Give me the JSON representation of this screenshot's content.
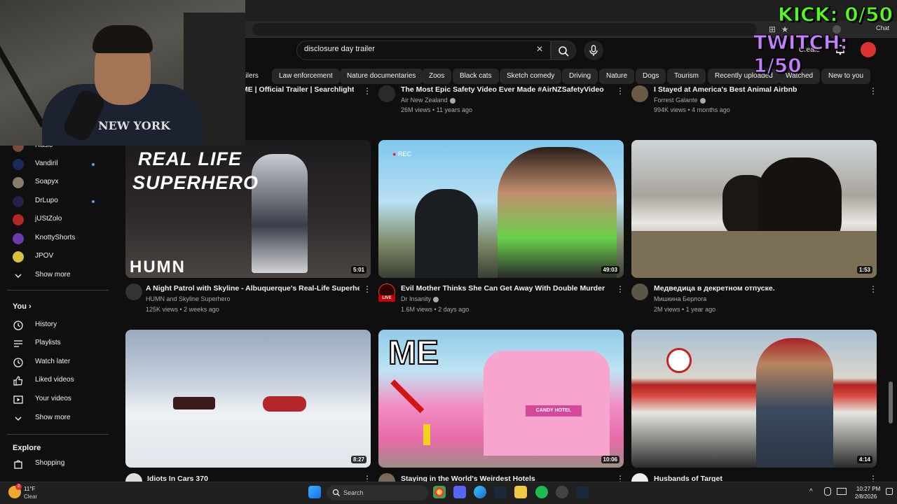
{
  "browser": {
    "chat_label": "Chat"
  },
  "overlay": {
    "kick": "KICK: 0/50",
    "twitch": "TWITCH: 1/50"
  },
  "webcam": {
    "hoodie_text": "NEW YORK"
  },
  "header": {
    "search_query": "disclosure day trailer",
    "create_label": "Create"
  },
  "chips": [
    "ailers",
    "Law enforcement",
    "Nature documentaries",
    "Zoos",
    "Black cats",
    "Sketch comedy",
    "Driving",
    "Nature",
    "Dogs",
    "Tourism",
    "Recently uploaded",
    "Watched",
    "New to you"
  ],
  "sidebar": {
    "subscriptions": [
      {
        "label": "Rasic",
        "icon": "channel-avatar"
      },
      {
        "label": "Vandiril",
        "icon": "channel-avatar",
        "live": true
      },
      {
        "label": "Soapyx",
        "icon": "channel-avatar"
      },
      {
        "label": "DrLupo",
        "icon": "channel-avatar",
        "live": true
      },
      {
        "label": "jUStZolo",
        "icon": "channel-avatar"
      },
      {
        "label": "KnottyShorts",
        "icon": "channel-avatar"
      },
      {
        "label": "JPOV",
        "icon": "channel-avatar"
      },
      {
        "label": "Show more",
        "icon": "chevron-down-icon"
      }
    ],
    "you_heading": "You",
    "you_items": [
      {
        "label": "History",
        "icon": "history-icon"
      },
      {
        "label": "Playlists",
        "icon": "playlists-icon"
      },
      {
        "label": "Watch later",
        "icon": "clock-icon"
      },
      {
        "label": "Liked videos",
        "icon": "thumbs-up-icon"
      },
      {
        "label": "Your videos",
        "icon": "your-videos-icon"
      },
      {
        "label": "Show more",
        "icon": "chevron-down-icon"
      }
    ],
    "explore_heading": "Explore",
    "explore_items": [
      {
        "label": "Shopping",
        "icon": "shopping-bag-icon"
      }
    ]
  },
  "top_row": [
    {
      "title": "ME | Official Trailer | Searchlight",
      "channel": "",
      "meta": ""
    },
    {
      "title": "The Most Epic Safety Video Ever Made #AirNZSafetyVideo",
      "channel": "Air New Zealand",
      "meta": "26M views • 11 years ago"
    },
    {
      "title": "I Stayed at America's Best Animal Airbnb",
      "channel": "Forrest Galante",
      "meta": "994K views • 4 months ago"
    }
  ],
  "videos": [
    {
      "title": "A Night Patrol with Skyline - Albuquerque's  Real-Life Superhero",
      "channel": "HUMN and Skyline Superhero",
      "meta": "125K views • 2 weeks ago",
      "duration": "5:01",
      "thumb_text_1": "REAL LIFE",
      "thumb_text_2": "SUPERHERO",
      "thumb_logo": "HUMN"
    },
    {
      "title": "Evil Mother Thinks She Can Get Away With Double Murder",
      "channel": "Dr Insanity",
      "meta": "1.6M views • 2 days ago",
      "duration": "49:03",
      "thumb_rec": "REC",
      "live_badge": "LIVE"
    },
    {
      "title": "Медведица в декретном отпуске.",
      "channel": "Мишкина Берлога",
      "meta": "2M views • 1 year ago",
      "duration": "1:53"
    },
    {
      "title": "Idiots In Cars 370",
      "channel": "",
      "meta": "",
      "duration": "8:27"
    },
    {
      "title": "Staying in the World's Weirdest Hotels",
      "channel": "",
      "meta": "",
      "duration": "10:06",
      "thumb_text_1": "ME",
      "thumb_sign": "CANDY HOTEL"
    },
    {
      "title": "Husbands of Target",
      "channel": "",
      "meta": "",
      "duration": "4:14"
    }
  ],
  "taskbar": {
    "weather_temp": "11°F",
    "weather_desc": "Clear",
    "search_label": "Search",
    "time": "10:27 PM",
    "date": "2/8/2026",
    "weather_badge": "2"
  }
}
